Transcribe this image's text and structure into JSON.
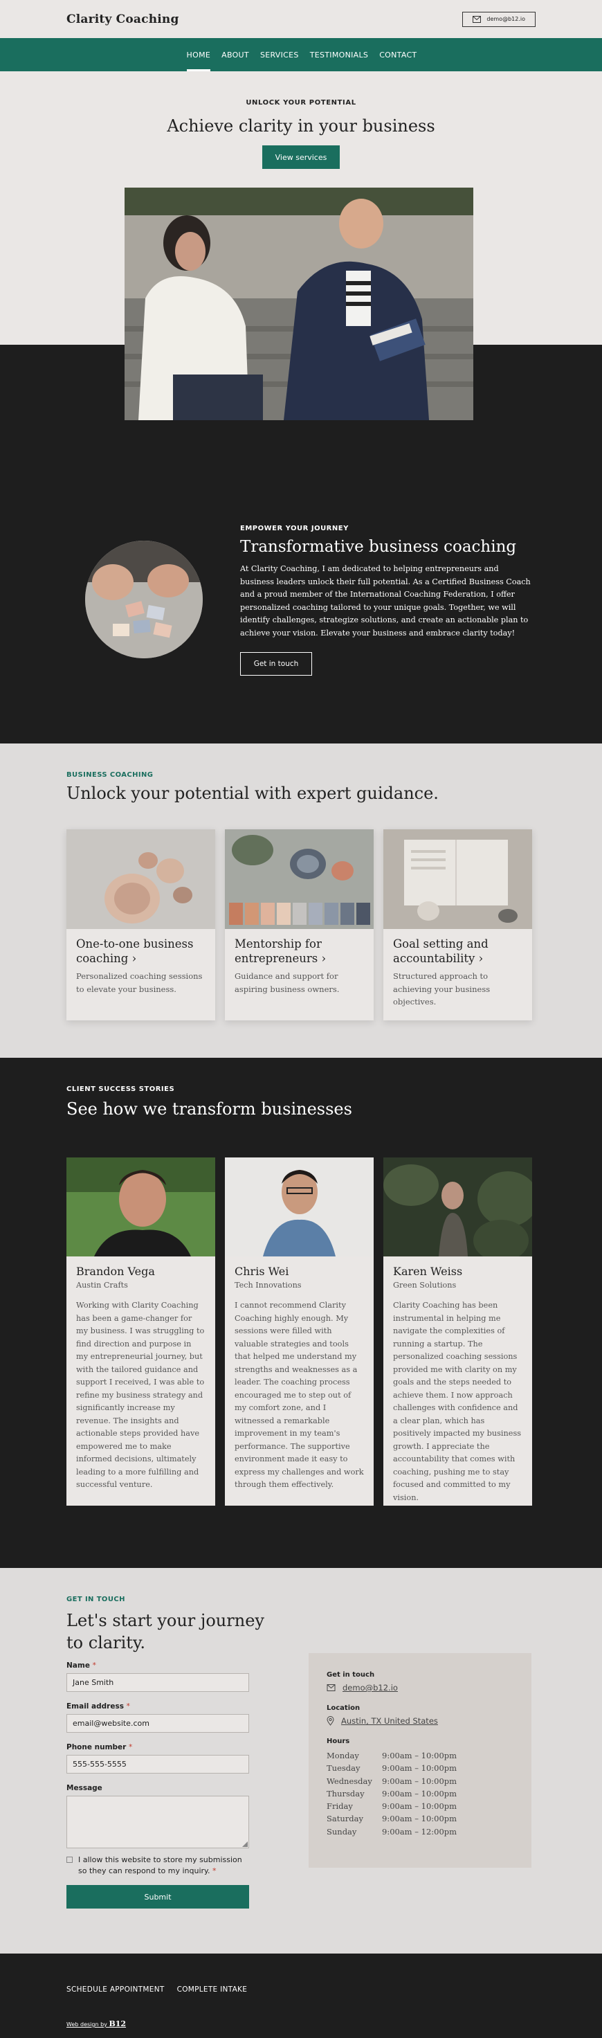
{
  "header": {
    "brand": "Clarity Coaching",
    "email": "demo@b12.io"
  },
  "nav": {
    "items": [
      "HOME",
      "ABOUT",
      "SERVICES",
      "TESTIMONIALS",
      "CONTACT"
    ],
    "active": "HOME"
  },
  "hero": {
    "eyebrow": "UNLOCK YOUR POTENTIAL",
    "title": "Achieve clarity in your business",
    "cta": "View services"
  },
  "empower": {
    "eyebrow": "EMPOWER YOUR JOURNEY",
    "title": "Transformative business coaching",
    "body": "At Clarity Coaching, I am dedicated to helping entrepreneurs and business leaders unlock their full potential. As a Certified Business Coach and a proud member of the International Coaching Federation, I offer personalized coaching tailored to your unique goals. Together, we will identify challenges, strategize solutions, and create an actionable plan to achieve your vision. Elevate your business and embrace clarity today!",
    "cta": "Get in touch"
  },
  "services": {
    "eyebrow": "BUSINESS COACHING",
    "title": "Unlock your potential with expert guidance.",
    "items": [
      {
        "title": "One-to-one business coaching",
        "desc": "Personalized coaching sessions to elevate your business."
      },
      {
        "title": "Mentorship for entrepreneurs",
        "desc": "Guidance and support for aspiring business owners."
      },
      {
        "title": "Goal setting and accountability",
        "desc": "Structured approach to achieving your business objectives."
      }
    ]
  },
  "stories": {
    "eyebrow": "CLIENT SUCCESS STORIES",
    "title": "See how we transform businesses",
    "items": [
      {
        "name": "Brandon Vega",
        "company": "Austin Crafts",
        "quote": "Working with Clarity Coaching has been a game-changer for my business. I was struggling to find direction and purpose in my entrepreneurial journey, but with the tailored guidance and support I received, I was able to refine my business strategy and significantly increase my revenue. The insights and actionable steps provided have empowered me to make informed decisions, ultimately leading to a more fulfilling and successful venture."
      },
      {
        "name": "Chris Wei",
        "company": "Tech Innovations",
        "quote": "I cannot recommend Clarity Coaching highly enough. My sessions were filled with valuable strategies and tools that helped me understand my strengths and weaknesses as a leader. The coaching process encouraged me to step out of my comfort zone, and I witnessed a remarkable improvement in my team's performance. The supportive environment made it easy to express my challenges and work through them effectively."
      },
      {
        "name": "Karen Weiss",
        "company": "Green Solutions",
        "quote": "Clarity Coaching has been instrumental in helping me navigate the complexities of running a startup. The personalized coaching sessions provided me with clarity on my goals and the steps needed to achieve them. I now approach challenges with confidence and a clear plan, which has positively impacted my business growth. I appreciate the accountability that comes with coaching, pushing me to stay focused and committed to my vision."
      }
    ]
  },
  "contact": {
    "eyebrow": "GET IN TOUCH",
    "title": "Let's start your journey to clarity.",
    "form": {
      "name_label": "Name",
      "name_value": "Jane Smith",
      "email_label": "Email address",
      "email_value": "email@website.com",
      "phone_label": "Phone number",
      "phone_value": "555-555-5555",
      "message_label": "Message",
      "message_value": "",
      "required_mark": "*",
      "consent": "I allow this website to store my submission so they can respond to my inquiry.",
      "submit": "Submit"
    },
    "info": {
      "get_in_touch_label": "Get in touch",
      "email": "demo@b12.io",
      "location_label": "Location",
      "location": "Austin, TX United States",
      "hours_label": "Hours",
      "hours": [
        {
          "day": "Monday",
          "time": "9:00am  –  10:00pm"
        },
        {
          "day": "Tuesday",
          "time": "9:00am  –  10:00pm"
        },
        {
          "day": "Wednesday",
          "time": "9:00am  –  10:00pm"
        },
        {
          "day": "Thursday",
          "time": "9:00am  –  10:00pm"
        },
        {
          "day": "Friday",
          "time": "9:00am  –  10:00pm"
        },
        {
          "day": "Saturday",
          "time": "9:00am  –  10:00pm"
        },
        {
          "day": "Sunday",
          "time": "9:00am  –  12:00pm"
        }
      ]
    }
  },
  "footer": {
    "links": [
      "SCHEDULE APPOINTMENT",
      "COMPLETE INTAKE"
    ],
    "credit_prefix": "Web design by",
    "credit_brand": "B12"
  },
  "colors": {
    "accent": "#1a6e5e",
    "dark": "#1e1e1e",
    "light": "#eae7e5"
  }
}
